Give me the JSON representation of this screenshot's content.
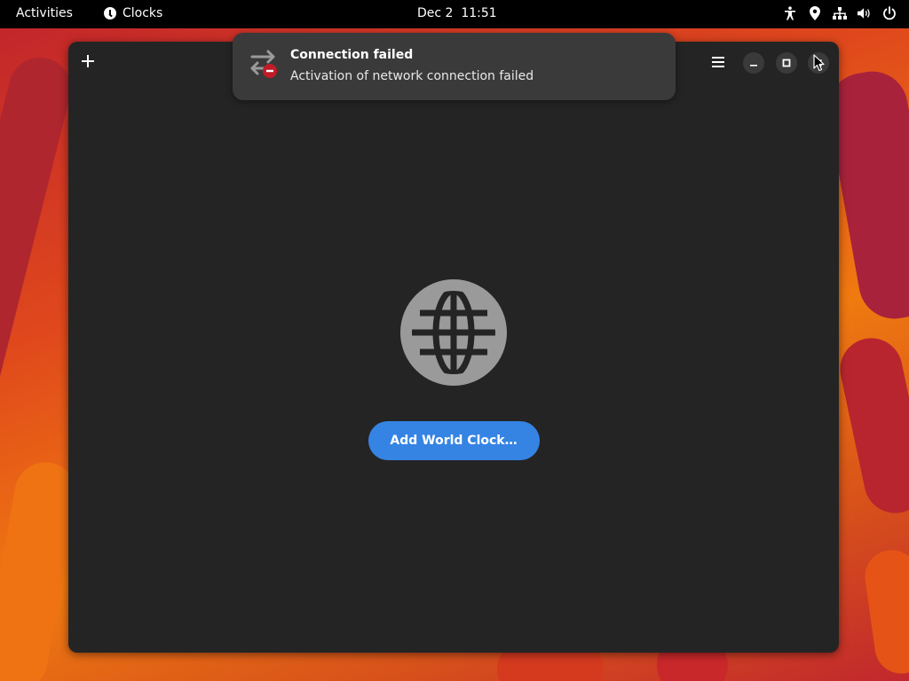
{
  "topbar": {
    "activities_label": "Activities",
    "app_name": "Clocks",
    "datetime": "Dec 2  11:51",
    "tray_icons": [
      "accessibility-icon",
      "location-icon",
      "network-icon",
      "volume-icon",
      "power-icon"
    ]
  },
  "window": {
    "header": {
      "add_icon": "plus-icon",
      "menu_icon": "hamburger-menu-icon",
      "controls": [
        "minimize-icon",
        "maximize-icon",
        "close-icon"
      ]
    },
    "empty_state": {
      "icon": "globe-icon",
      "button_label": "Add World Clock…"
    }
  },
  "notification": {
    "icon": "network-error-icon",
    "title": "Connection failed",
    "body": "Activation of network connection failed"
  },
  "colors": {
    "accent": "#3584e4",
    "window_bg": "#242424",
    "notification_bg": "#3a3a3a",
    "error_red": "#c01c28"
  }
}
